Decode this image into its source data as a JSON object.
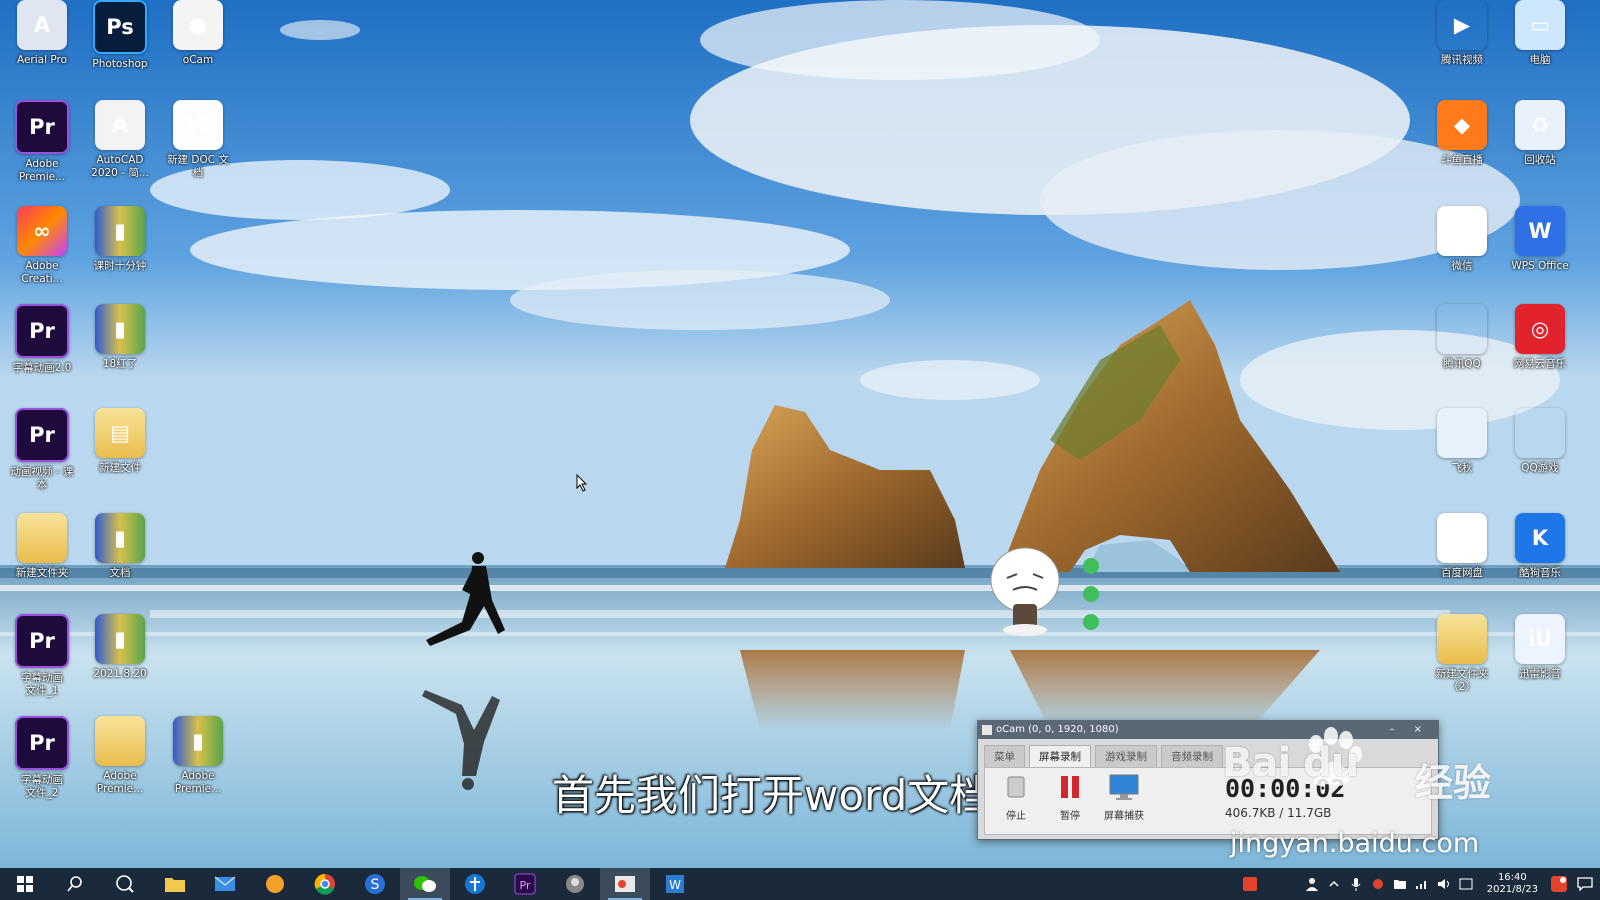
{
  "desktop": {
    "icons_left": [
      {
        "label": "Aerial Pro",
        "glyph": "A",
        "style": "t-aero",
        "icon": "aerial-pro-icon"
      },
      {
        "label": "Photoshop",
        "glyph": "Ps",
        "style": "t-ps",
        "icon": "photoshop-icon"
      },
      {
        "label": "oCam",
        "glyph": "●",
        "style": "t-ocam",
        "icon": "ocam-icon"
      },
      {
        "label": "Adobe\nPremie...",
        "glyph": "Pr",
        "style": "t-pr",
        "icon": "premiere-icon"
      },
      {
        "label": "AutoCAD\n2020 - 简...",
        "glyph": "A",
        "style": "t-cad",
        "icon": "autocad-icon"
      },
      {
        "label": "新建 DOC 文\n档",
        "glyph": "W",
        "style": "t-doc",
        "icon": "word-document-icon"
      },
      {
        "label": "Adobe\nCreati...",
        "glyph": "∞",
        "style": "t-cc",
        "icon": "creative-cloud-icon"
      },
      {
        "label": "课时十分钟",
        "glyph": "▮",
        "style": "t-book",
        "icon": "book-file-icon"
      },
      {
        "label": "",
        "glyph": "",
        "style": "",
        "icon": ""
      },
      {
        "label": "字幕动画2.0",
        "glyph": "Pr",
        "style": "t-pr",
        "icon": "premiere-project-icon"
      },
      {
        "label": "18红了",
        "glyph": "▮",
        "style": "t-book",
        "icon": "book-file-icon"
      },
      {
        "label": "",
        "glyph": "",
        "style": "",
        "icon": ""
      },
      {
        "label": "动画视频 - 课\n本",
        "glyph": "Pr",
        "style": "t-pr",
        "icon": "premiere-project-icon"
      },
      {
        "label": "新建文件",
        "glyph": "▤",
        "style": "t-folder",
        "icon": "folder-icon"
      },
      {
        "label": "",
        "glyph": "",
        "style": "",
        "icon": ""
      },
      {
        "label": "新建文件夹",
        "glyph": "",
        "style": "t-folder",
        "icon": "folder-icon"
      },
      {
        "label": "文档",
        "glyph": "▮",
        "style": "t-book",
        "icon": "book-file-icon"
      },
      {
        "label": "",
        "glyph": "",
        "style": "",
        "icon": ""
      },
      {
        "label": "字幕动画\n文件_1",
        "glyph": "Pr",
        "style": "t-pr",
        "icon": "premiere-project-icon"
      },
      {
        "label": "2021.8.20",
        "glyph": "▮",
        "style": "t-book",
        "icon": "book-file-icon"
      },
      {
        "label": "",
        "glyph": "",
        "style": "",
        "icon": ""
      },
      {
        "label": "字幕动画\n文件_2",
        "glyph": "Pr",
        "style": "t-pr",
        "icon": "premiere-project-icon"
      },
      {
        "label": "Adobe\nPremie...",
        "glyph": "",
        "style": "t-folder",
        "icon": "folder-icon"
      },
      {
        "label": "Adobe\nPremie...",
        "glyph": "▮",
        "style": "t-book",
        "icon": "book-file-icon"
      }
    ],
    "icons_right": [
      {
        "label": "腾讯视频",
        "glyph": "▶",
        "style": "t-txvideo",
        "icon": "tencent-video-icon"
      },
      {
        "label": "电脑",
        "glyph": "▭",
        "style": "t-pc",
        "icon": "computer-icon"
      },
      {
        "label": "斗鱼直播",
        "glyph": "◆",
        "style": "t-orange",
        "icon": "douyu-icon"
      },
      {
        "label": "回收站",
        "glyph": "♻",
        "style": "t-bin",
        "icon": "recycle-bin-icon"
      },
      {
        "label": "微信",
        "glyph": "",
        "style": "t-wechat",
        "icon": "wechat-icon"
      },
      {
        "label": "WPS Office",
        "glyph": "W",
        "style": "t-wps",
        "icon": "wps-office-icon"
      },
      {
        "label": "腾讯QQ",
        "glyph": "",
        "style": "t-qq",
        "icon": "qq-icon"
      },
      {
        "label": "网易云音乐",
        "glyph": "◎",
        "style": "t-netease",
        "icon": "netease-music-icon"
      },
      {
        "label": "飞秋",
        "glyph": "",
        "style": "t-feiq",
        "icon": "feiq-icon"
      },
      {
        "label": "QQ游戏",
        "glyph": "",
        "style": "t-game",
        "icon": "qq-game-icon"
      },
      {
        "label": "百度网盘",
        "glyph": "",
        "style": "t-baidu",
        "icon": "baidu-netdisk-icon"
      },
      {
        "label": "酷狗音乐",
        "glyph": "K",
        "style": "t-kugou",
        "icon": "kugou-icon"
      },
      {
        "label": "新建文件夹\n（2）",
        "glyph": "",
        "style": "t-folder",
        "icon": "folder-icon"
      },
      {
        "label": "迅雷影音",
        "glyph": "iU",
        "style": "t-iu",
        "icon": "iu-player-icon"
      }
    ]
  },
  "ocam": {
    "title": "oCam (0, 0, 1920, 1080)",
    "window_buttons": "– ×",
    "tabs": [
      "菜单",
      "屏幕录制",
      "游戏录制",
      "音频录制"
    ],
    "tools": [
      {
        "label": "停止",
        "icon": "record-stop-icon"
      },
      {
        "label": "暂停",
        "icon": "pause-icon"
      },
      {
        "label": "屏幕捕获",
        "icon": "screen-capture-icon"
      }
    ],
    "timer": "00:00:02",
    "size": "406.7KB / 11.7GB"
  },
  "subtitle": "首先我们打开word文档",
  "watermark": {
    "logo": "Bai du",
    "text": "经验",
    "url": "jingyan.baidu.com"
  },
  "taskbar": {
    "clock_time": "16:40",
    "clock_date": "2021/8/23"
  },
  "colors": {
    "sky_top": "#2a7fd0",
    "sea": "#9cc8e0",
    "taskbar": "#1b2a3a"
  }
}
